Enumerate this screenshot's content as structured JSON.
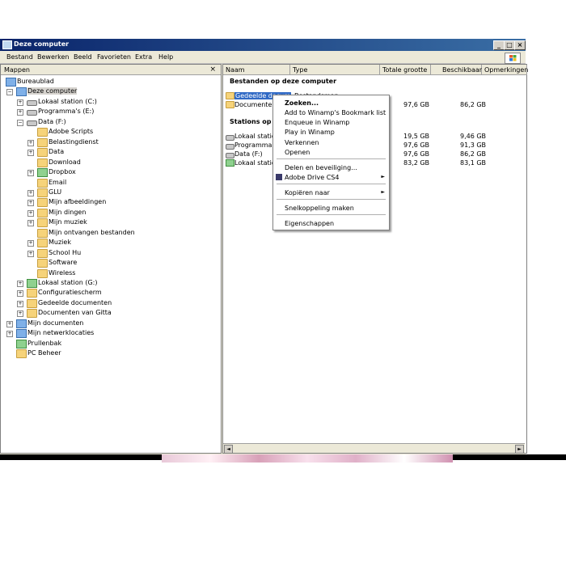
{
  "window": {
    "title": "Deze computer",
    "controls": [
      "_",
      "□",
      "×"
    ]
  },
  "menubar": {
    "items": [
      "Bestand",
      "Bewerken",
      "Beeld",
      "Favorieten",
      "Extra",
      "Help"
    ]
  },
  "folders_pane": {
    "header": "Mappen",
    "close": "×",
    "tree": [
      {
        "label": "Bureaublad",
        "expander": ""
      },
      {
        "label": "Deze computer",
        "expander": "−"
      },
      {
        "label": "Lokaal station (C:)",
        "expander": "+"
      },
      {
        "label": "Programma's (E:)",
        "expander": "+"
      },
      {
        "label": "Data (F:)",
        "expander": "−"
      },
      {
        "label": "Adobe Scripts",
        "expander": ""
      },
      {
        "label": "Belastingdienst",
        "expander": "+"
      },
      {
        "label": "Data",
        "expander": "+"
      },
      {
        "label": "Download",
        "expander": ""
      },
      {
        "label": "Dropbox",
        "expander": "+"
      },
      {
        "label": "Email",
        "expander": ""
      },
      {
        "label": "GLU",
        "expander": "+"
      },
      {
        "label": "Mijn afbeeldingen",
        "expander": "+"
      },
      {
        "label": "Mijn dingen",
        "expander": "+"
      },
      {
        "label": "Mijn muziek",
        "expander": "+"
      },
      {
        "label": "Mijn ontvangen bestanden",
        "expander": ""
      },
      {
        "label": "Muziek",
        "expander": "+"
      },
      {
        "label": "School Hu",
        "expander": "+"
      },
      {
        "label": "Software",
        "expander": ""
      },
      {
        "label": "Wireless",
        "expander": ""
      },
      {
        "label": "Lokaal station (G:)",
        "expander": "+"
      },
      {
        "label": "Configuratiescherm",
        "expander": "+"
      },
      {
        "label": "Gedeelde documenten",
        "expander": "+"
      },
      {
        "label": "Documenten van Gitta",
        "expander": "+"
      },
      {
        "label": "Mijn documenten",
        "expander": "+"
      },
      {
        "label": "Mijn netwerklocaties",
        "expander": "+"
      },
      {
        "label": "Prullenbak",
        "expander": ""
      },
      {
        "label": "PC Beheer",
        "expander": ""
      }
    ]
  },
  "content": {
    "columns": [
      "Naam",
      "Type",
      "Totale grootte",
      "Beschikbaar",
      "Opmerkingen"
    ],
    "section_files": "Bestanden op deze computer",
    "files": [
      {
        "name": "Gedeelde docum",
        "type": "Bestandsmap",
        "total": "",
        "free": ""
      },
      {
        "name": "Documenten",
        "type": "",
        "total": "97,6 GB",
        "free": "86,2 GB"
      }
    ],
    "section_drives": "Stations op lo",
    "drives": [
      {
        "name": "Lokaal station",
        "total": "19,5 GB",
        "free": "9,46 GB"
      },
      {
        "name": "Programma's",
        "total": "97,6 GB",
        "free": "91,3 GB"
      },
      {
        "name": "Data (F:)",
        "total": "97,6 GB",
        "free": "86,2 GB"
      },
      {
        "name": "Lokaal station",
        "total": "83,2 GB",
        "free": "83,1 GB"
      }
    ],
    "scroll_left": "◄",
    "scroll_right": "►"
  },
  "context_menu": {
    "items": [
      {
        "label": "Zoeken...",
        "bold": true,
        "submenu": false
      },
      {
        "label": "Add to Winamp's Bookmark list",
        "submenu": false
      },
      {
        "label": "Enqueue in Winamp",
        "submenu": false
      },
      {
        "label": "Play in Winamp",
        "submenu": false
      },
      {
        "label": "Verkennen",
        "submenu": false
      },
      {
        "label": "Openen",
        "submenu": false
      },
      {
        "label": "Delen en beveiliging...",
        "submenu": false
      },
      {
        "label": "Adobe Drive CS4",
        "submenu": true
      },
      {
        "label": "Kopiëren naar",
        "submenu": true
      },
      {
        "label": "Snelkoppeling maken",
        "submenu": false
      },
      {
        "label": "Eigenschappen",
        "submenu": false
      }
    ],
    "submenu_arrow": "►"
  }
}
